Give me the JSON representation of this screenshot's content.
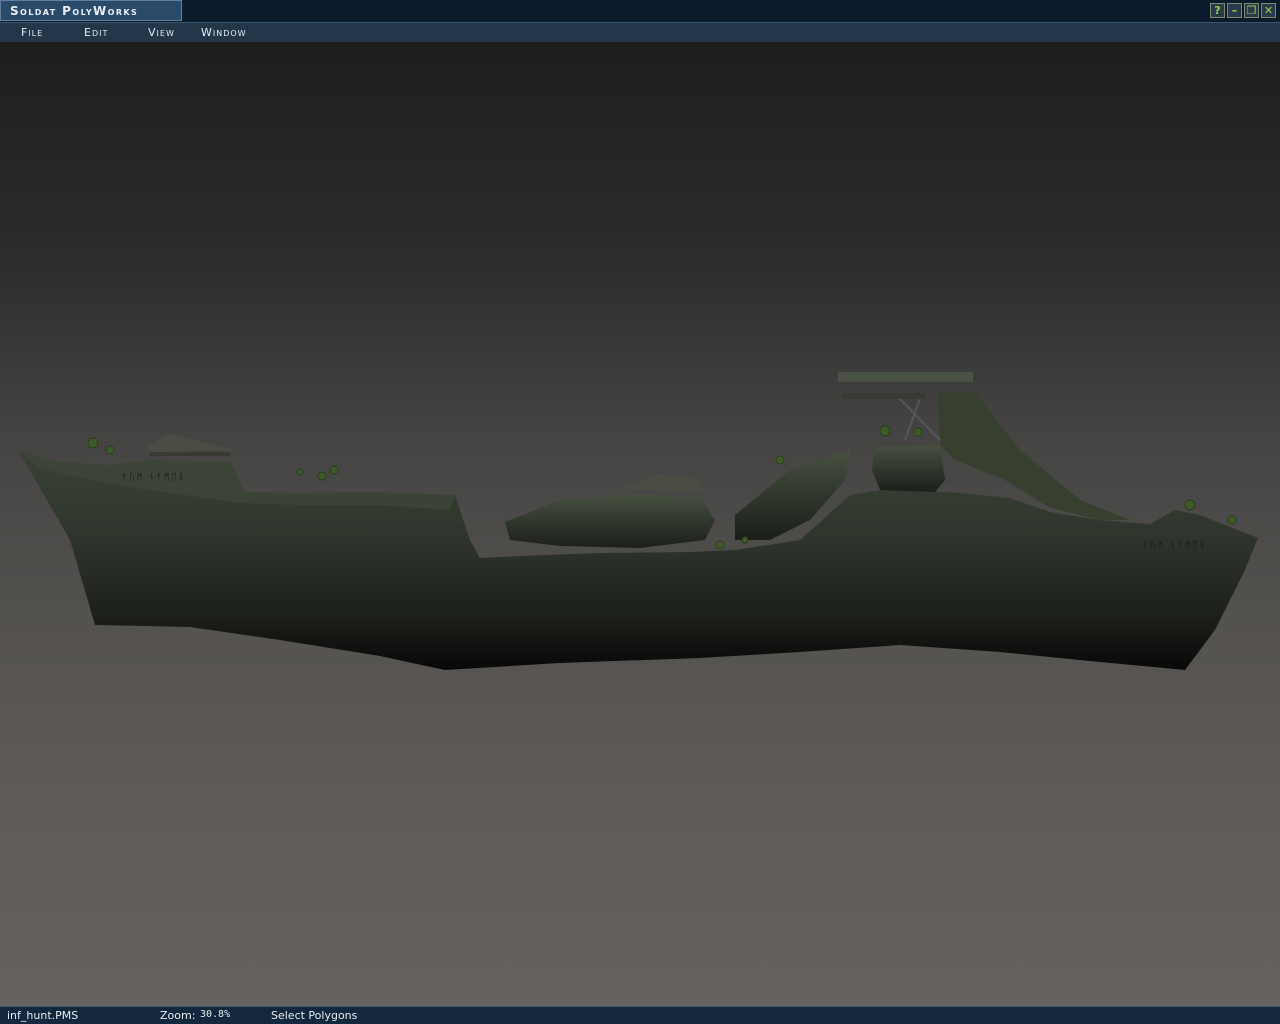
{
  "window": {
    "title": "Soldat PolyWorks",
    "buttons": {
      "help": "?",
      "minimize": "–",
      "restore": "❐",
      "close": "✕"
    }
  },
  "menu": {
    "file": "File",
    "edit": "Edit",
    "view": "View",
    "window": "Window"
  },
  "canvas": {
    "background_top": "#1e1e1e",
    "background_bottom": "#67625f",
    "terrain_color": "#2e342d"
  },
  "status": {
    "file": "inf_hunt.PMS",
    "zoom_label": "Zoom:",
    "zoom_value": "30.8%",
    "mode": "Select Polygons"
  }
}
